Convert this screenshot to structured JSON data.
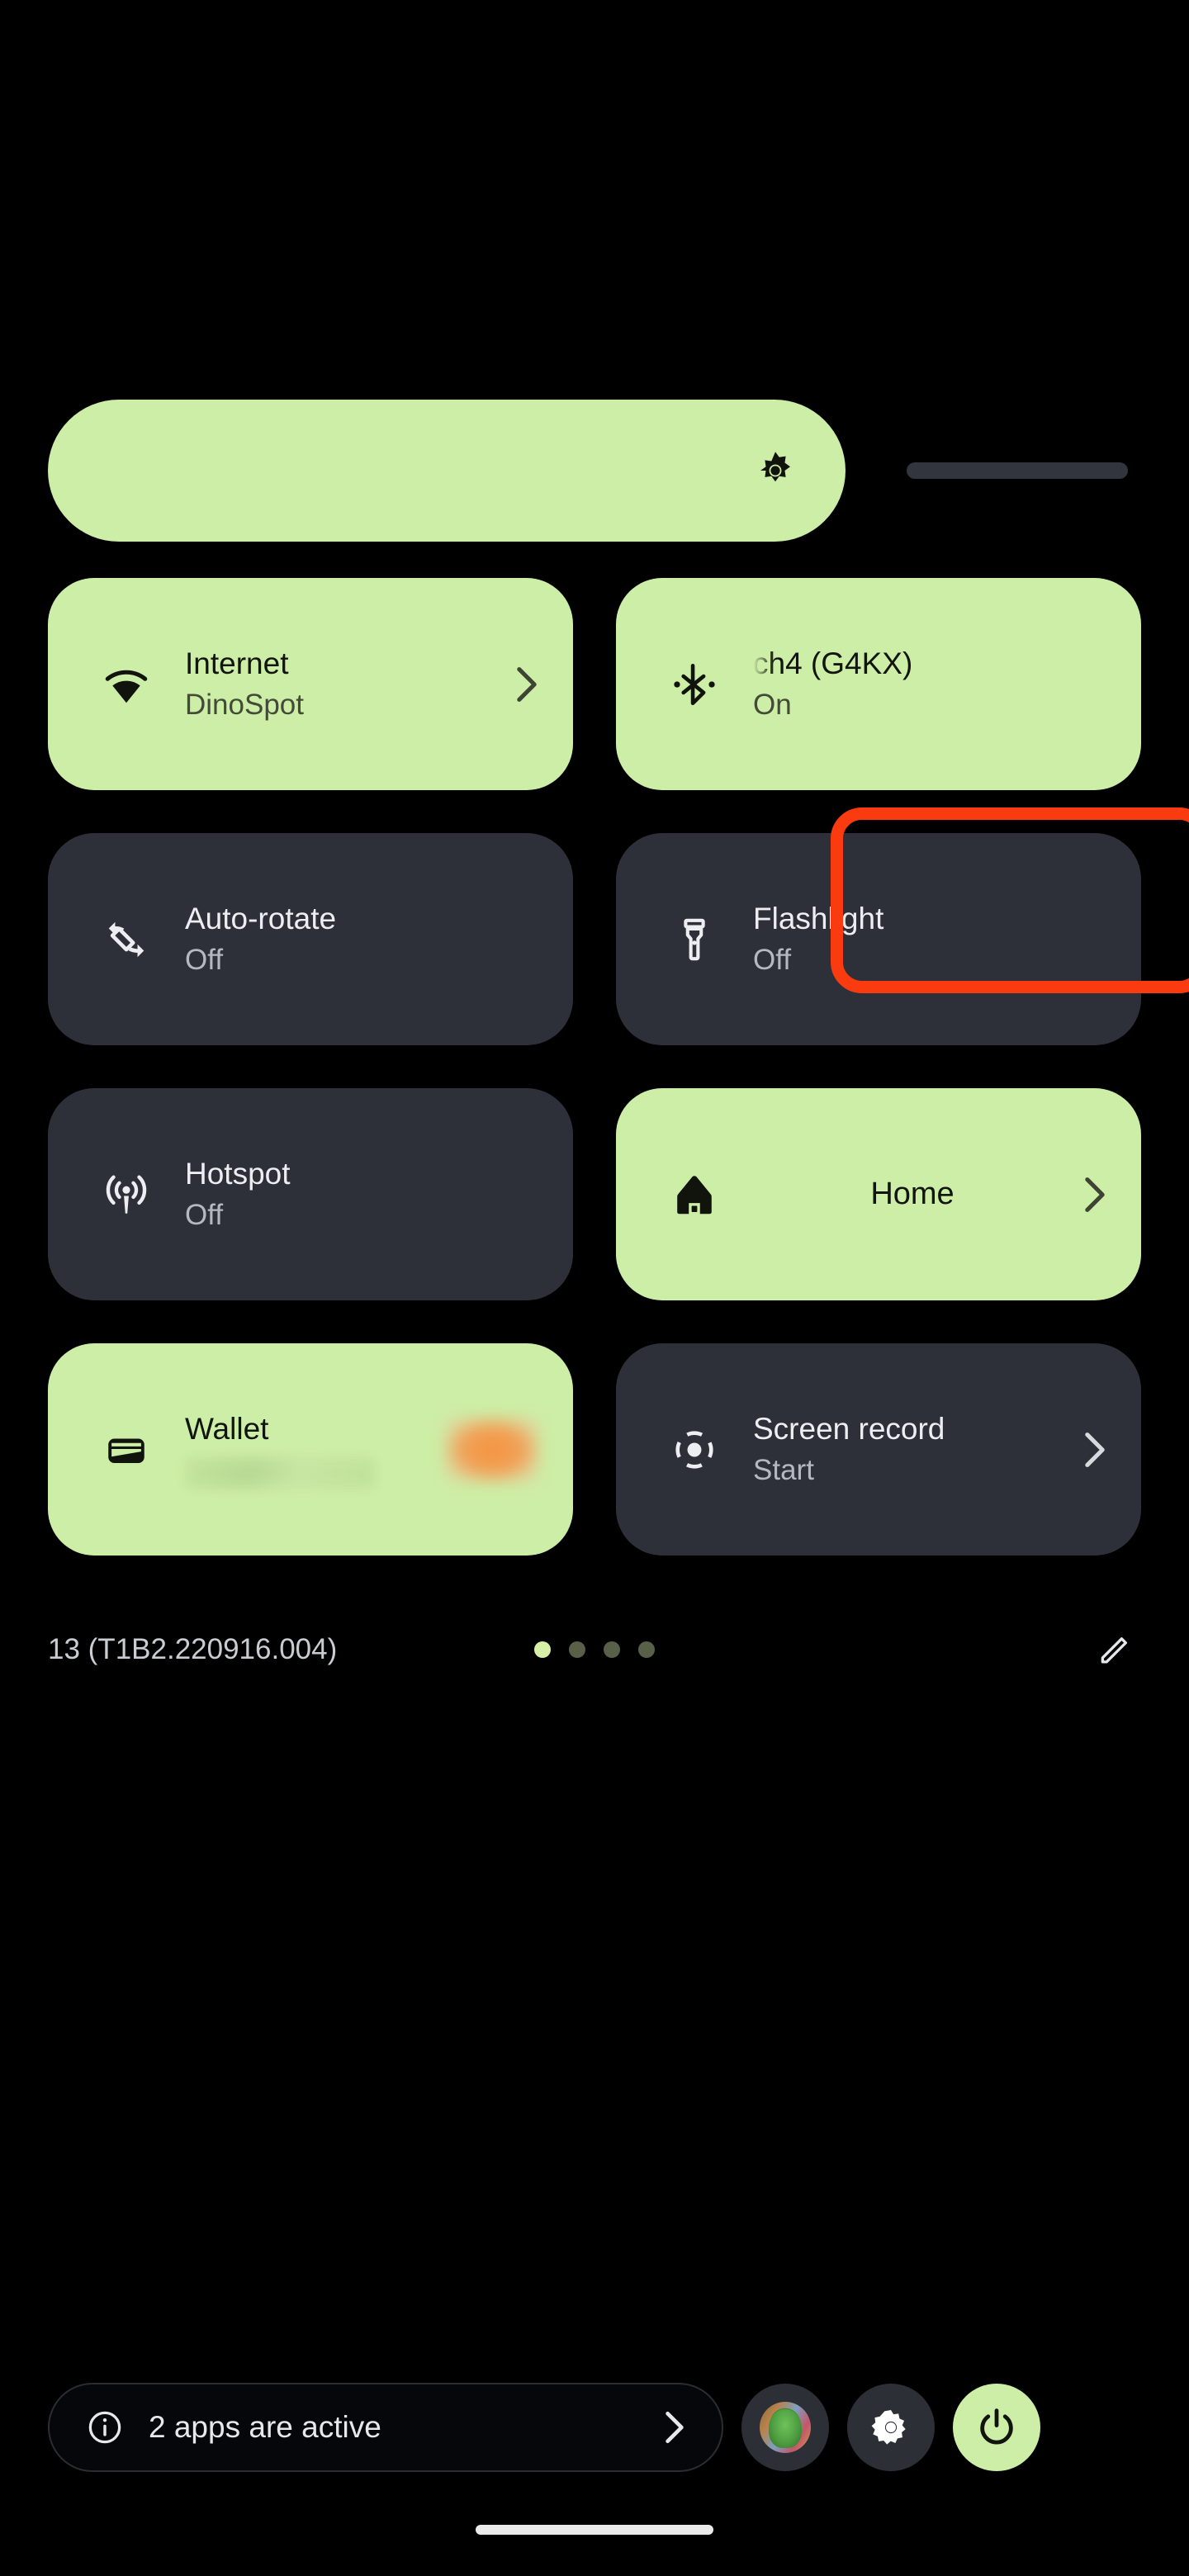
{
  "brightness": {
    "icon": "brightness-sun-icon",
    "fill_percent": 73,
    "accent_color": "#cdeea6",
    "track_color": "#32353d"
  },
  "tiles": [
    {
      "name": "internet",
      "icon": "wifi-icon",
      "label": "Internet",
      "sub": "DinoSpot",
      "state": "on",
      "chevron": true
    },
    {
      "name": "bluetooth",
      "icon": "bluetooth-icon",
      "label": "ch4 (G4KX)",
      "sub": "On",
      "state": "on",
      "chevron": false
    },
    {
      "name": "auto-rotate",
      "icon": "auto-rotate-icon",
      "label": "Auto-rotate",
      "sub": "Off",
      "state": "off",
      "chevron": false
    },
    {
      "name": "flashlight",
      "icon": "flashlight-icon",
      "label": "Flashlight",
      "sub": "Off",
      "state": "off",
      "chevron": false,
      "highlighted": true
    },
    {
      "name": "hotspot",
      "icon": "hotspot-icon",
      "label": "Hotspot",
      "sub": "Off",
      "state": "off",
      "chevron": false
    },
    {
      "name": "home",
      "icon": "home-icon",
      "label": "Home",
      "sub": "",
      "state": "on",
      "chevron": true
    },
    {
      "name": "wallet",
      "icon": "wallet-icon",
      "label": "Wallet",
      "sub": "",
      "state": "on",
      "chevron": false
    },
    {
      "name": "screen-record",
      "icon": "screen-record-icon",
      "label": "Screen record",
      "sub": "Start",
      "state": "off",
      "chevron": true
    }
  ],
  "footer": {
    "build": "13 (T1B2.220916.004)",
    "page_dots": {
      "total": 4,
      "active_index": 0
    },
    "edit_icon": "pencil-edit-icon"
  },
  "bottom_bar": {
    "info_icon": "info-circle-icon",
    "active_apps_text": "2 apps are active",
    "chevron_icon": "chevron-right-icon",
    "avatar": "user-avatar",
    "settings_icon": "gear-icon",
    "power_icon": "power-icon"
  },
  "colors": {
    "background": "#000000",
    "tile_on": "#cdeea6",
    "tile_off": "#2d3038",
    "highlight": "#fa3b0f",
    "text_on_light": "#12150e",
    "text_on_dark": "#eceef1"
  }
}
